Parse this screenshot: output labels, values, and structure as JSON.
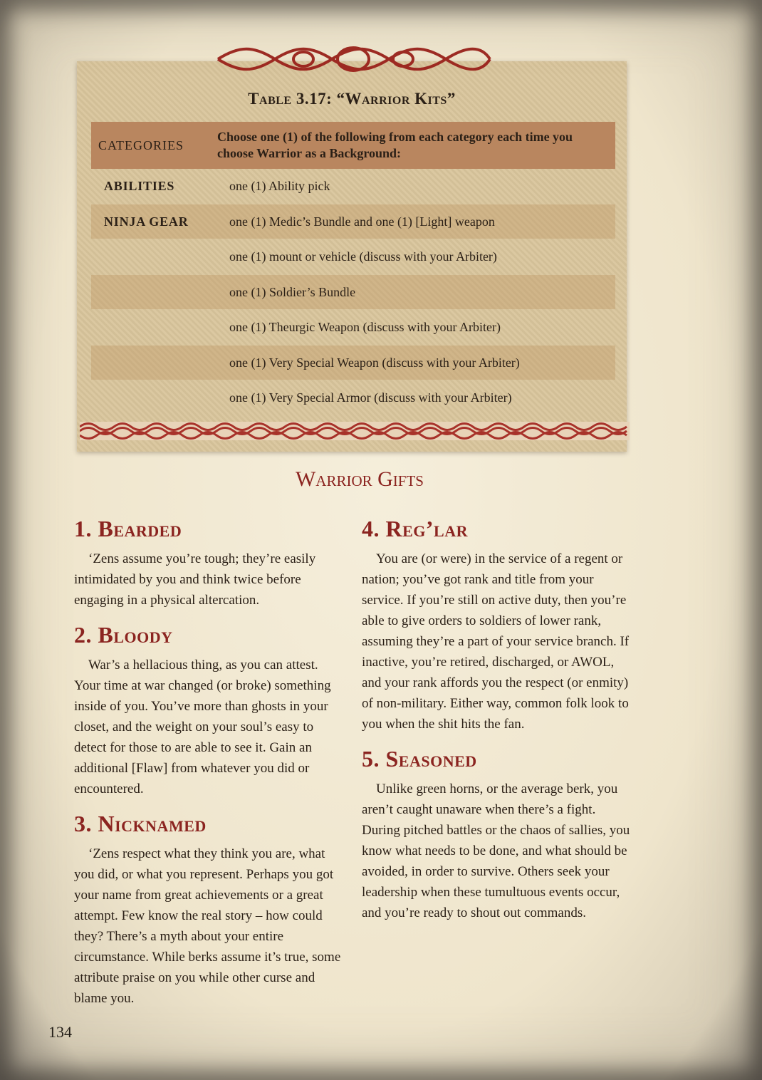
{
  "table": {
    "title": "Table 3.17: “Warrior Kits”",
    "header": {
      "category_label": "CATEGORIES",
      "description": "Choose one (1) of the following from each category each time you choose Warrior as a Background:"
    },
    "rows": [
      {
        "category": "ABILITIES",
        "value": "one (1) Ability pick"
      },
      {
        "category": "NINJA GEAR",
        "value": "one (1) Medic’s Bundle and one (1) [Light] weapon"
      },
      {
        "category": "",
        "value": "one (1) mount or vehicle (discuss with your Arbiter)"
      },
      {
        "category": "",
        "value": "one (1) Soldier’s Bundle"
      },
      {
        "category": "",
        "value": "one (1) Theurgic Weapon (discuss with your Arbiter)"
      },
      {
        "category": "",
        "value": "one (1) Very Special Weapon (discuss with your Arbiter)"
      },
      {
        "category": "",
        "value": "one (1) Very Special Armor (discuss with your Arbiter)"
      }
    ]
  },
  "section_title": "Warrior Gifts",
  "gifts": [
    {
      "title": "1. Bearded",
      "body": "‘Zens assume you’re tough; they’re easily intimidated by you and think twice before engaging in a physical altercation."
    },
    {
      "title": "2. Bloody",
      "body": "War’s a hellacious thing, as you can attest. Your time at war changed (or broke) something inside of you. You’ve more than ghosts in your closet, and the weight on your soul’s easy to detect for those to are able to see it. Gain an additional [Flaw] from whatever you did or encountered."
    },
    {
      "title": "3. Nicknamed",
      "body": "‘Zens respect what they think you are, what you did, or what you represent. Perhaps you got your name from great achievements or a great attempt. Few know the real story – how could they? There’s a myth about your entire circumstance. While berks assume it’s true, some attribute praise on you while other curse and blame you."
    },
    {
      "title": "4. Reg’lar",
      "body": "You are (or were) in the service of a regent or nation; you’ve got rank and title from your service. If you’re still on active duty, then you’re able to give orders to soldiers of lower rank, assuming they’re a part of your service branch. If inactive, you’re retired, discharged, or AWOL, and your rank affords you the respect (or enmity) of non-military. Either way, common folk look to you when the shit hits the fan."
    },
    {
      "title": "5. Seasoned",
      "body": "Unlike green horns, or the average berk, you aren’t caught unaware when there’s a fight. During pitched battles or the chaos of sallies, you know what needs to be done,  and what should be avoided, in order to survive. Others seek your leadership when these tumultuous events occur, and you’re ready to shout out commands."
    }
  ],
  "page_number": "134",
  "colors": {
    "accent_red": "#8b2420",
    "table_header": "#b9865f",
    "panel": "#d9c59c",
    "text": "#2a1f16"
  }
}
